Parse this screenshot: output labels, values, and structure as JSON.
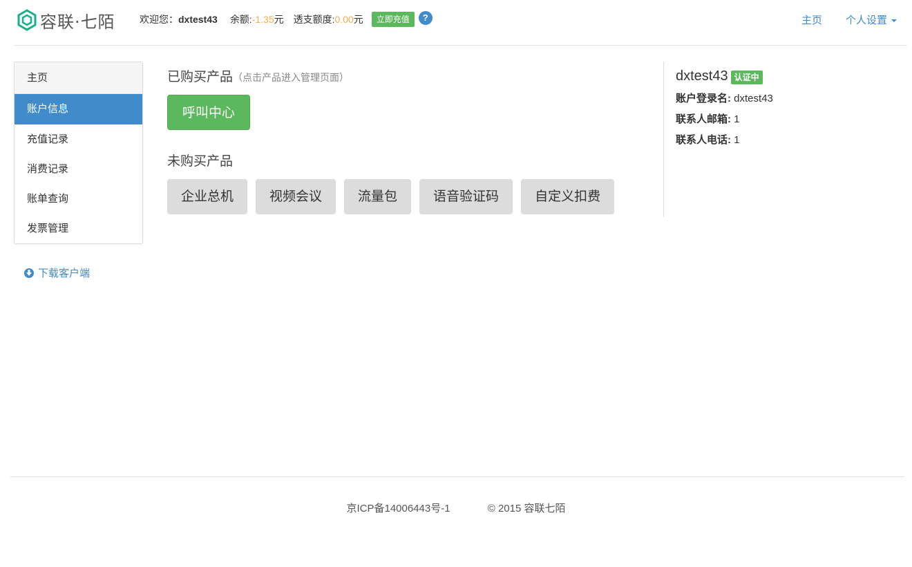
{
  "brand": {
    "name": "容联·七陌",
    "accent": "#1aaf8b"
  },
  "account_bar": {
    "welcome": "欢迎您：",
    "username": "dxtest43",
    "balance_label": "余额:",
    "balance_value": "-1.35",
    "balance_unit": "元",
    "overdraft_label": "透支额度:",
    "overdraft_value": "0.00",
    "overdraft_unit": "元",
    "recharge_label": "立即充值",
    "help_glyph": "?"
  },
  "topnav": {
    "home": "主页",
    "settings": "个人设置"
  },
  "sidebar": {
    "items": [
      {
        "label": "主页"
      },
      {
        "label": "账户信息"
      },
      {
        "label": "充值记录"
      },
      {
        "label": "消费记录"
      },
      {
        "label": "账单查询"
      },
      {
        "label": "发票管理"
      }
    ],
    "download_label": "下载客户端"
  },
  "main": {
    "bought_title": "已购买产品",
    "bought_hint": "（点击产品进入管理页面）",
    "bought": [
      {
        "label": "呼叫中心"
      }
    ],
    "unbought_title": "未购买产品",
    "unbought": [
      {
        "label": "企业总机"
      },
      {
        "label": "视频会议"
      },
      {
        "label": "流量包"
      },
      {
        "label": "语音验证码"
      },
      {
        "label": "自定义扣费"
      }
    ]
  },
  "profile": {
    "name": "dxtest43",
    "badge": "认证中",
    "login_label": "账户登录名:",
    "login_value": "dxtest43",
    "email_label": "联系人邮箱:",
    "email_value": "1",
    "phone_label": "联系人电话:",
    "phone_value": "1"
  },
  "footer": {
    "icp": "京ICP备14006443号-1",
    "copyright": "© 2015 容联七陌"
  },
  "colors": {
    "primary": "#428bca",
    "success": "#5cb85c",
    "warning": "#f0ad4e"
  }
}
